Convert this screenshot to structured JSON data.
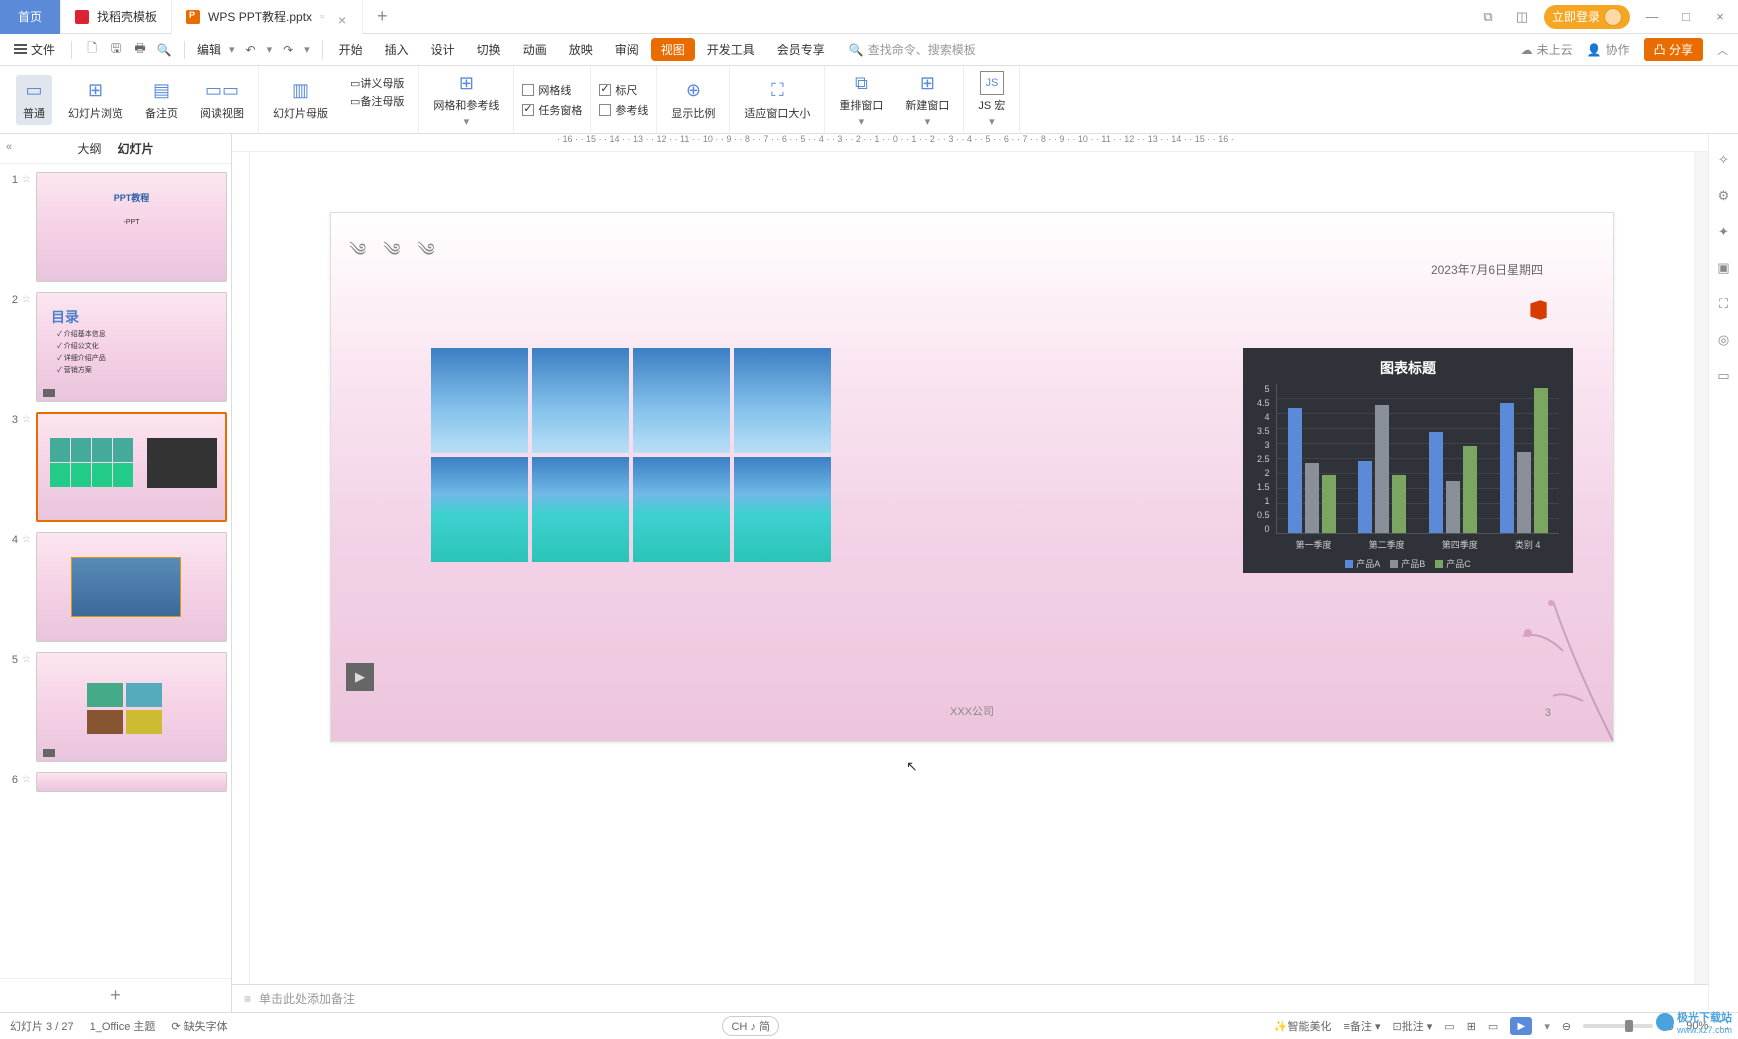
{
  "titlebar": {
    "home": "首页",
    "tab_templates": "找稻壳模板",
    "tab_doc": "WPS PPT教程.pptx",
    "login": "立即登录"
  },
  "menubar": {
    "file": "文件",
    "edit": "编辑",
    "tabs": [
      "开始",
      "插入",
      "设计",
      "切换",
      "动画",
      "放映",
      "审阅",
      "视图",
      "开发工具",
      "会员专享"
    ],
    "active": "视图",
    "search_placeholder": "查找命令、搜索模板",
    "not_cloud": "未上云",
    "collab": "协作",
    "share": "分享"
  },
  "ribbon": {
    "normal": "普通",
    "slide_browse": "幻灯片浏览",
    "notes_page": "备注页",
    "reading_view": "阅读视图",
    "slide_master": "幻灯片母版",
    "lecture_master": "讲义母版",
    "notes_master": "备注母版",
    "grid_guides": "网格和参考线",
    "gridlines": "网格线",
    "task_pane": "任务窗格",
    "ruler": "标尺",
    "guides": "参考线",
    "zoom_ratio": "显示比例",
    "fit_window": "适应窗口大小",
    "rearrange_window": "重排窗口",
    "new_window": "新建窗口",
    "js_macro": "JS 宏"
  },
  "panel": {
    "outline": "大纲",
    "slides": "幻灯片",
    "slide2_title": "目录",
    "slide2_items": [
      "介绍基本信息",
      "介绍公文化",
      "详细介绍产品",
      "营销方案"
    ]
  },
  "slide": {
    "date": "2023年7月6日星期四",
    "footer_company": "XXX公司",
    "page_number": "3"
  },
  "chart_data": {
    "type": "bar",
    "title": "图表标题",
    "categories": [
      "第一季度",
      "第二季度",
      "第四季度",
      "类别 4"
    ],
    "series": [
      {
        "name": "产品A",
        "values": [
          4.3,
          2.5,
          3.5,
          4.5
        ]
      },
      {
        "name": "产品B",
        "values": [
          2.4,
          4.4,
          1.8,
          2.8
        ]
      },
      {
        "name": "产品C",
        "values": [
          2.0,
          2.0,
          3.0,
          5.0
        ]
      }
    ],
    "ylim": [
      0,
      5
    ],
    "yticks": [
      0,
      0.5,
      1,
      1.5,
      2,
      2.5,
      3,
      3.5,
      4,
      4.5,
      5
    ],
    "colors": {
      "产品A": "#5a8ad8",
      "产品B": "#8a9099",
      "产品C": "#7aa661"
    }
  },
  "notes": {
    "placeholder": "单击此处添加备注"
  },
  "statusbar": {
    "slide_info": "幻灯片 3 / 27",
    "theme": "1_Office 主题",
    "missing_fonts": "缺失字体",
    "lang": "CH ♪ 简",
    "smart_beautify": "智能美化",
    "notes_toggle": "备注",
    "comments_toggle": "批注",
    "zoom": "90%"
  },
  "watermark": {
    "name": "极光下载站",
    "url": "www.xz7.com"
  },
  "icons": {
    "search": "🔍",
    "cloud": "☁",
    "collab": "👤"
  }
}
